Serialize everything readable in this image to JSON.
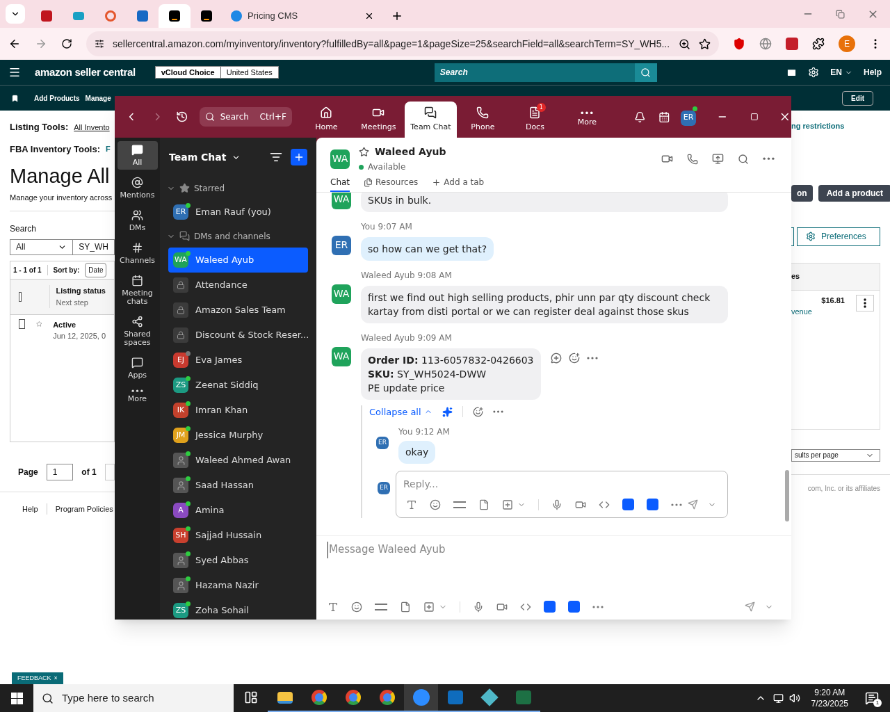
{
  "browser": {
    "tabs": [
      {
        "kind": "red",
        "selected": false
      },
      {
        "kind": "teal",
        "selected": false
      },
      {
        "kind": "orange",
        "selected": false
      },
      {
        "kind": "blue",
        "selected": false
      },
      {
        "kind": "amazon",
        "selected": true
      },
      {
        "kind": "amazon",
        "selected": false
      },
      {
        "kind": "dollar",
        "title": "Pricing CMS",
        "selected": false
      }
    ],
    "url": "sellercentral.amazon.com/myinventory/inventory?fulfilledBy=all&page=1&pageSize=25&searchField=all&searchTerm=SY_WH5...",
    "profile": "E"
  },
  "amazon": {
    "logo": "amazon seller central",
    "account": "vCloud Choice",
    "region": "United States",
    "search_placeholder": "Search",
    "lang": "EN",
    "help": "Help",
    "nav": [
      "Add Products",
      "Manage"
    ],
    "edit": "Edit",
    "listing_tools_label": "Listing Tools:",
    "listing_tools_link": "All Invento",
    "fba_label": "FBA Inventory Tools:",
    "fba_link": "F",
    "title": "Manage All",
    "subtitle": "Manage your inventory across",
    "restrictions_link": "ng restrictions",
    "partial_button": "on",
    "add_product": "Add a product",
    "search_label": "Search",
    "search_scope": "All",
    "search_value": "SY_WH",
    "preferences": "Preferences",
    "count": "1 - 1 of 1",
    "sort_label": "Sort by:",
    "sort_value": "Date",
    "header_checked": false,
    "col_status": "Listing status",
    "col_status_sub": "Next step",
    "col_right": "es",
    "row": {
      "checked": false,
      "starred": false,
      "status": "Active",
      "date": "Jun 12, 2025, 0",
      "price": "$16.81",
      "link": "venue"
    },
    "page_label": "Page",
    "page_value": "1",
    "page_of": "of 1",
    "per_page": "sults per page",
    "footer_links": [
      "Help",
      "Program Policies"
    ],
    "copyright": "com, Inc. or its affiliates",
    "feedback": "FEEDBACK",
    "feedback_close": "×"
  },
  "zoom": {
    "search": "Search",
    "shortcut": "Ctrl+F",
    "avatar": "ER",
    "tabs": [
      {
        "label": "Home",
        "selected": false
      },
      {
        "label": "Meetings",
        "selected": false
      },
      {
        "label": "Team Chat",
        "selected": true
      },
      {
        "label": "Phone",
        "selected": false
      },
      {
        "label": "Docs",
        "selected": false,
        "badge": "1"
      },
      {
        "label": "More",
        "selected": false
      }
    ],
    "rail": [
      {
        "label": "All",
        "selected": true
      },
      {
        "label": "Mentions",
        "selected": false
      },
      {
        "label": "DMs",
        "selected": false
      },
      {
        "label": "Channels",
        "selected": false
      },
      {
        "label": "Meeting chats",
        "selected": false
      },
      {
        "label": "Shared spaces",
        "selected": false
      },
      {
        "label": "Apps",
        "selected": false
      },
      {
        "label": "More",
        "selected": false
      }
    ],
    "sidebar": {
      "title": "Team Chat",
      "sections": [
        {
          "label": "Starred",
          "expanded": true,
          "items": [
            {
              "name": "Eman Rauf (you)",
              "kind": "initials",
              "initials": "ER",
              "color": "#2f6fb3",
              "online": true,
              "selected": false
            }
          ]
        },
        {
          "label": "DMs and channels",
          "expanded": true,
          "items": [
            {
              "name": "Waleed Ayub",
              "kind": "initials",
              "initials": "WA",
              "color": "#1fa35b",
              "online": true,
              "selected": true
            },
            {
              "name": "Attendance",
              "kind": "channel",
              "selected": false
            },
            {
              "name": "Amazon Sales Team",
              "kind": "channel",
              "selected": false
            },
            {
              "name": "Discount & Stock Reser...",
              "kind": "channel",
              "selected": false
            },
            {
              "name": "Eva James",
              "kind": "initials",
              "initials": "EJ",
              "color": "#c93a2f",
              "online": false,
              "selected": false
            },
            {
              "name": "Zeenat Siddiq",
              "kind": "initials",
              "initials": "ZS",
              "color": "#1c9a82",
              "online": true,
              "selected": false
            },
            {
              "name": "Imran Khan",
              "kind": "initials",
              "initials": "IK",
              "color": "#c3412c",
              "online": true,
              "selected": false
            },
            {
              "name": "Jessica Murphy",
              "kind": "initials",
              "initials": "JM",
              "color": "#e0a11c",
              "online": true,
              "selected": false
            },
            {
              "name": "Waleed Ahmed Awan",
              "kind": "photo",
              "online": true,
              "selected": false
            },
            {
              "name": "Saad Hassan",
              "kind": "photo",
              "online": true,
              "selected": false
            },
            {
              "name": "Amina",
              "kind": "initials",
              "initials": "A",
              "color": "#8a4ac0",
              "online": true,
              "selected": false
            },
            {
              "name": "Sajjad Hussain",
              "kind": "initials",
              "initials": "SH",
              "color": "#c8402e",
              "online": true,
              "selected": false
            },
            {
              "name": "Syed Abbas",
              "kind": "photo",
              "online": true,
              "selected": false
            },
            {
              "name": "Hazama Nazir",
              "kind": "photo",
              "online": true,
              "selected": false
            },
            {
              "name": "Zoha Sohail",
              "kind": "initials",
              "initials": "ZS",
              "color": "#1c9a82",
              "online": true,
              "selected": false
            }
          ]
        }
      ]
    },
    "chat": {
      "name": "Waleed Ayub",
      "initials": "WA",
      "color": "#1fa35b",
      "starred": false,
      "status": "Available",
      "online": true,
      "tabs": [
        {
          "label": "Chat",
          "selected": true
        },
        {
          "label": "Resources",
          "selected": false
        }
      ],
      "add_tab": "Add a tab",
      "messages": [
        {
          "initials": "WA",
          "color": "#1fa35b",
          "mine": false,
          "lines": [
            "SKUs in bulk."
          ]
        },
        {
          "sender": "You",
          "time": "9:07 AM",
          "initials": "ER",
          "color": "#2f6fb3",
          "mine": true,
          "lines": [
            "so how can we get that?"
          ]
        },
        {
          "sender": "Waleed Ayub",
          "time": "9:08 AM",
          "initials": "WA",
          "color": "#1fa35b",
          "mine": false,
          "lines": [
            "first we find out high selling products, phir unn par qty discount check kartay from disti portal or we can register deal against those skus"
          ]
        },
        {
          "sender": "Waleed Ayub",
          "time": "9:09 AM",
          "initials": "WA",
          "color": "#1fa35b",
          "mine": false,
          "actions": true,
          "lines": [
            "**Order ID:** 113-6057832-0426603",
            "**SKU:** SY_WH5024-DWW",
            "PE update price"
          ]
        }
      ],
      "thread": {
        "collapse": "Collapse all",
        "replies": [
          {
            "sender": "You",
            "time": "9:12 AM",
            "initials": "ER",
            "color": "#2f6fb3",
            "text": "okay"
          }
        ],
        "reply_initials": "ER",
        "reply_placeholder": "Reply..."
      },
      "composer_placeholder": "Message Waleed Ayub"
    }
  },
  "taskbar": {
    "search": "Type here to search",
    "time": "9:20 AM",
    "date": "7/23/2025",
    "notifications": "1",
    "apps": [
      {
        "kind": "taskview",
        "selected": false
      },
      {
        "kind": "folder",
        "selected": false
      },
      {
        "kind": "chrome",
        "selected": false
      },
      {
        "kind": "chrome",
        "selected": false
      },
      {
        "kind": "chrome",
        "selected": false
      },
      {
        "kind": "zoom",
        "selected": true
      },
      {
        "kind": "outlook",
        "selected": false
      },
      {
        "kind": "diamond",
        "selected": false
      },
      {
        "kind": "excel",
        "selected": false
      }
    ]
  }
}
